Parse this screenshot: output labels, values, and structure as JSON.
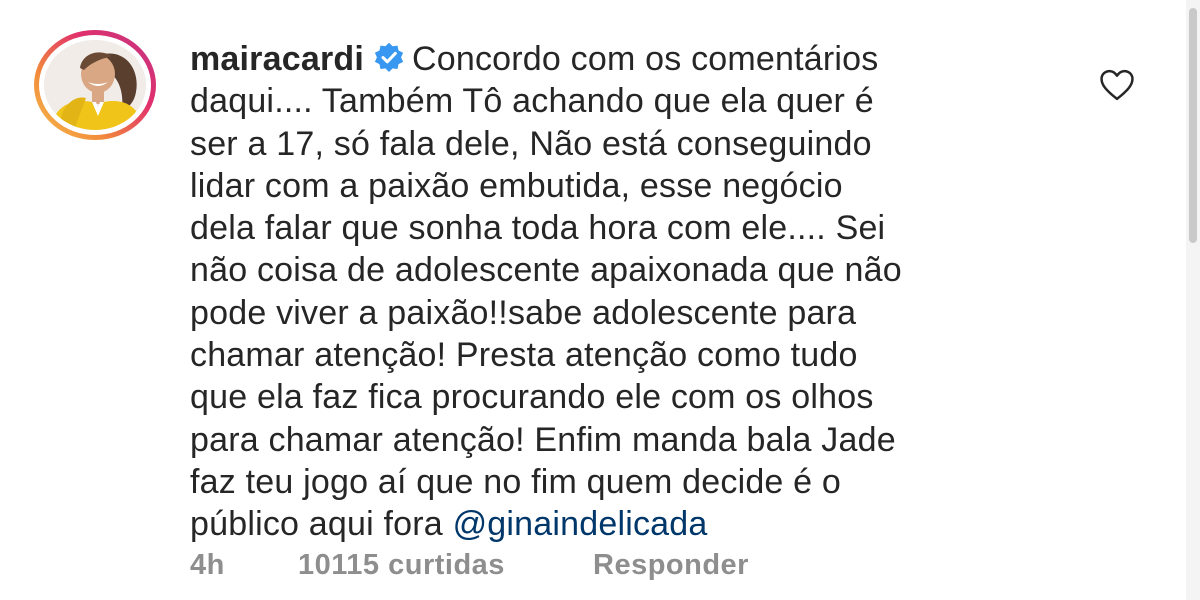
{
  "comment": {
    "username": "mairacardi",
    "verified": true,
    "text_lines": [
      "Concordo com os comentários",
      "daqui.... Também Tô achando que ela quer é",
      "ser a 17, só fala dele, Não está conseguindo",
      "lidar com a paixão embutida, esse negócio",
      "dela falar que sonha toda hora com ele.... Sei",
      "não coisa de adolescente apaixonada que não",
      "pode viver a paixão!!sabe adolescente para",
      "chamar atenção! Presta atenção como tudo",
      "que ela faz fica procurando ele com os olhos",
      "para chamar atenção! Enfim manda bala Jade",
      "faz teu jogo aí que no fim quem  decide é o",
      "público aqui fora"
    ],
    "mention": "@ginaindelicada"
  },
  "meta": {
    "time_ago": "4h",
    "likes": "10115 curtidas",
    "reply_label": "Responder"
  },
  "icons": {
    "like": "heart-outline-icon",
    "verified": "verified-badge-icon"
  },
  "colors": {
    "text": "#262626",
    "secondary": "#8e8e8e",
    "mention": "#00376b",
    "verified": "#3897f0"
  }
}
